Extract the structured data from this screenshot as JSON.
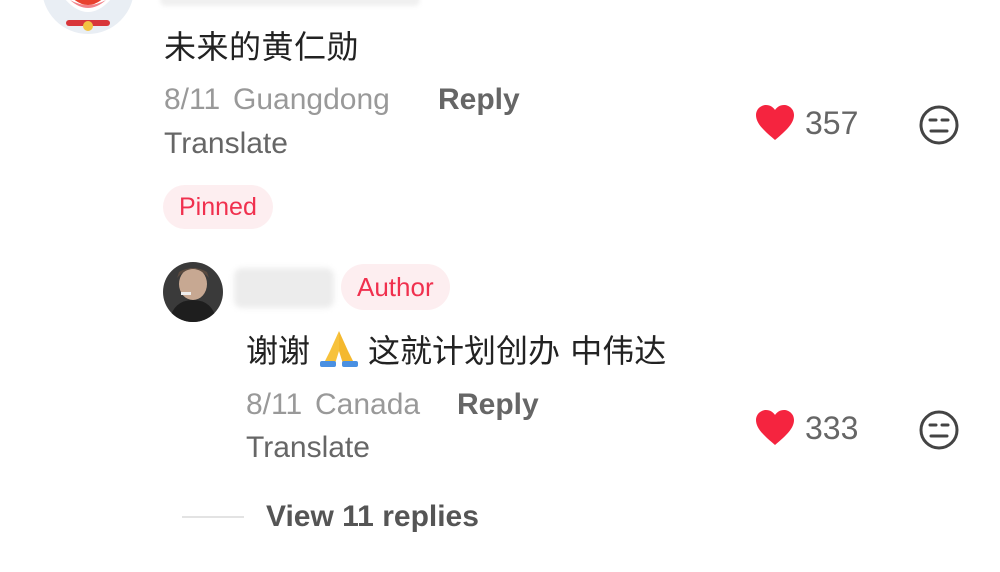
{
  "comment": {
    "text": "未来的黄仁勋",
    "date": "8/11",
    "location": "Guangdong",
    "reply_label": "Reply",
    "translate_label": "Translate",
    "likes": "357",
    "pinned_label": "Pinned"
  },
  "reply": {
    "author_badge": "Author",
    "text_before": "谢谢",
    "text_after": "这就计划创办 中伟达",
    "date": "8/11",
    "location": "Canada",
    "reply_label": "Reply",
    "translate_label": "Translate",
    "likes": "333"
  },
  "view_replies_label": "View 11 replies",
  "colors": {
    "heart": "#f5243f",
    "badge_bg": "#fdeef0",
    "badge_text": "#f0304e"
  },
  "icons": {
    "like": "heart-icon",
    "dislike": "neutral-face-icon",
    "emoji": "praying-hands-emoji"
  }
}
